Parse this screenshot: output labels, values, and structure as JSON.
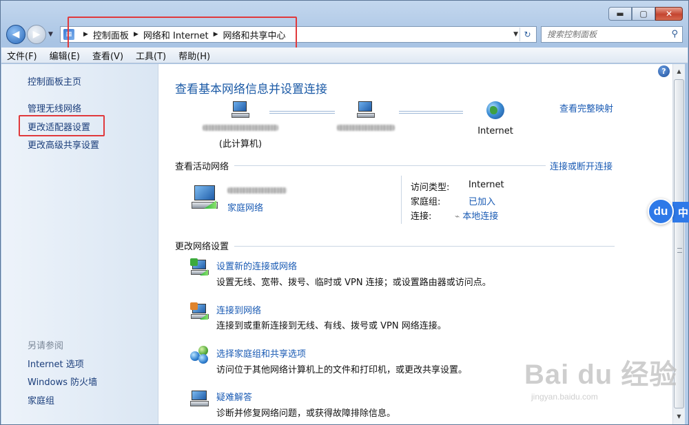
{
  "window": {
    "caption_buttons": {
      "minimize": "▬",
      "maximize": "▢",
      "close": "✕"
    }
  },
  "address_bar": {
    "crumbs": [
      "控制面板",
      "网络和 Internet",
      "网络和共享中心"
    ],
    "search_placeholder": "搜索控制面板"
  },
  "menu": [
    "文件(F)",
    "编辑(E)",
    "查看(V)",
    "工具(T)",
    "帮助(H)"
  ],
  "sidebar": {
    "home": "控制面板主页",
    "links": [
      "管理无线网络",
      "更改适配器设置",
      "更改高级共享设置"
    ],
    "see_also_heading": "另请参阅",
    "see_also": [
      "Internet 选项",
      "Windows 防火墙",
      "家庭组"
    ]
  },
  "main": {
    "title": "查看基本网络信息并设置连接",
    "full_map_link": "查看完整映射",
    "map": {
      "this_computer_label": "(此计算机)",
      "internet_label": "Internet"
    },
    "active_networks": {
      "heading": "查看活动网络",
      "connect_link": "连接或断开连接",
      "network_type": "家庭网络",
      "access_type_key": "访问类型:",
      "access_type_val": "Internet",
      "homegroup_key": "家庭组:",
      "homegroup_val": "已加入",
      "connections_key": "连接:",
      "connections_val": "本地连接"
    },
    "change_settings": {
      "heading": "更改网络设置",
      "tasks": [
        {
          "title": "设置新的连接或网络",
          "desc": "设置无线、宽带、拨号、临时或 VPN 连接；或设置路由器或访问点。"
        },
        {
          "title": "连接到网络",
          "desc": "连接到或重新连接到无线、有线、拨号或 VPN 网络连接。"
        },
        {
          "title": "选择家庭组和共享选项",
          "desc": "访问位于其他网络计算机上的文件和打印机，或更改共享设置。"
        },
        {
          "title": "疑难解答",
          "desc": "诊断并修复网络问题，或获得故障排除信息。"
        }
      ]
    }
  },
  "overlay": {
    "du_badge": "du",
    "du_tail": "中",
    "watermark_big": "Bai du 经验",
    "watermark_small": "jingyan.baidu.com"
  },
  "colors": {
    "link": "#1a5bb4",
    "highlight_box": "#e0383b",
    "title": "#1b5aa6"
  }
}
